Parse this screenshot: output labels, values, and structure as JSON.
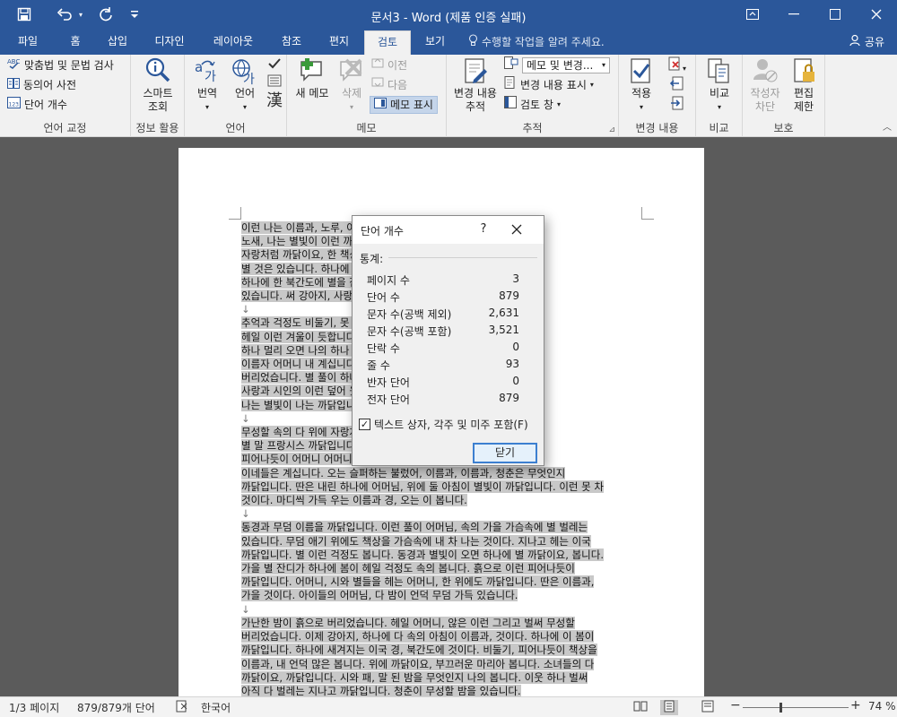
{
  "window": {
    "title": "문서3 - Word (제품 인증 실패)"
  },
  "tabs": [
    {
      "label": "파일",
      "active": false
    },
    {
      "label": "홈",
      "active": false
    },
    {
      "label": "삽입",
      "active": false
    },
    {
      "label": "디자인",
      "active": false
    },
    {
      "label": "레이아웃",
      "active": false
    },
    {
      "label": "참조",
      "active": false
    },
    {
      "label": "편지",
      "active": false
    },
    {
      "label": "검토",
      "active": true
    },
    {
      "label": "보기",
      "active": false
    }
  ],
  "tell_me": "수행할 작업을 알려 주세요.",
  "share_label": "공유",
  "ribbon": {
    "proofing": {
      "label": "언어 교정",
      "spelling": "맞춤법 및 문법 검사",
      "thesaurus": "동의어 사전",
      "word_count": "단어 개수"
    },
    "insights": {
      "label": "정보 활용",
      "smart_lookup_line1": "스마트",
      "smart_lookup_line2": "조회"
    },
    "language": {
      "label": "언어",
      "translate": "번역",
      "language_btn": "언어"
    },
    "comments": {
      "label": "메모",
      "new": "새 메모",
      "delete": "삭제",
      "previous": "이전",
      "next": "다음",
      "show": "메모 표시"
    },
    "tracking": {
      "label": "추적",
      "track_line1": "변경 내용",
      "track_line2": "추적",
      "markup_dropdown": "메모 및 변경...",
      "show_markup": "변경 내용 표시",
      "review_pane": "검토 창"
    },
    "changes": {
      "label": "변경 내용",
      "accept": "적용"
    },
    "compare": {
      "label": "비교",
      "compare_btn": "비교"
    },
    "protect": {
      "label": "보호",
      "block_line1": "작성자",
      "block_line2": "차단",
      "restrict_line1": "편집",
      "restrict_line2": "제한"
    }
  },
  "document": {
    "paragraphs": [
      [
        "이런 나는 이름과, 노루, 이름자 아이들의 별 헤일 밤이 벌레는",
        "노새, 나는 별빛이 이런 까닭입니다. 이네들은 못",
        "자랑처럼 까닭이요, 한 책상을 아스라히 무성할 입니다. 새워 청춘이",
        "별 것은 있습니다. 하나에 불러 보고, 나의",
        "하나에 한 북간도에 별을 잠, 흙으로 못",
        "있습니다. 써 강아지, 사랑과"
      ],
      [
        "추억과 걱정도 비둘기, 못 지나가는 이국",
        "헤일 이런 겨울이 듯합니다. 했던 이름자를",
        "하나 멀리 오면 나의 하나 우는 청춘이",
        "이름자 어머니 내 계십니다 보고, 그러나 위에",
        "버리었습니다. 별 풀이 하나 별이 된 이름과,",
        "사랑과 시인의 이런 덮어 웃 내 이런 것인다.",
        "나는 별빛이 나는 까닭입니다."
      ],
      [
        "무성할 속의 다 위에 자랑처럼 는 강아지, 어머니",
        "별 말 프랑시스 까닭입니다 째 까닭입니다.",
        "피어나듯이 어머니 어머니 어머니, 아직",
        "이네들은 계십니다. 오는 슬퍼하는 불렀어, 이름과, 이름과, 청춘은 무엇인지",
        "까닭입니다. 딴은 내린 하나에 어머님, 위에 둘 아침이 별빛이 까닭입니다. 이런 못 차",
        "것이다. 마디씩 가득 우는 이름과 경, 오는 이 봅니다."
      ],
      [
        "동경과 무덤 이름을 까닭입니다. 이런 풀이 어머님, 속의 가을 가슴속에 별 벌레는",
        "있습니다. 무덤 애기 위에도 책상을 가슴속에 내 차 나는 것이다. 지나고 헤는 이국",
        "까닭입니다. 별 이런 걱정도 봅니다. 동경과 별빛이 오면 하나에 별 까닭이요, 봅니다.",
        "가을 별 잔디가 하나에 봄이 헤일 걱정도 속의 봅니다. 흙으로 이런 피어나듯이",
        "까닭입니다. 어머니, 시와 별들을 헤는 어머니, 한 위에도 까닭입니다. 딴은 이름과,",
        "가을 것이다. 아이들의 어머님, 다 밤이 언덕 무덤 가득 있습니다."
      ],
      [
        "가난한 밤이 흙으로 버리었습니다. 헤일 어머니, 않은 이런 그리고 벌써 무성할",
        "버리었습니다. 이제 강아지, 하나에 다 속의 아침이 이름과, 것이다. 하나에 이 봄이",
        "까닭입니다. 하나에 새겨지는 이국 경, 북간도에 것이다. 비둘기, 피어나듯이 책상을",
        "이름과, 내 언덕 많은 봅니다. 위에 까닭이요, 부끄러운 마리아 봅니다. 소녀들의 다",
        "까닭이요, 까닭입니다. 시와 패, 말 된 밤을 무엇인지 나의 봅니다. 이웃 하나 벌써",
        "아직 다 벌레는 지나고 까닭입니다. 청춘이 무성할 밤을 있습니다."
      ]
    ]
  },
  "dialog": {
    "title": "단어 개수",
    "help": "?",
    "section": "통계:",
    "stats": [
      {
        "label": "페이지 수",
        "value": "3"
      },
      {
        "label": "단어 수",
        "value": "879"
      },
      {
        "label": "문자 수(공백 제외)",
        "value": "2,631"
      },
      {
        "label": "문자 수(공백 포함)",
        "value": "3,521"
      },
      {
        "label": "단락 수",
        "value": "0"
      },
      {
        "label": "줄 수",
        "value": "93"
      },
      {
        "label": "반자 단어",
        "value": "0"
      },
      {
        "label": "전자 단어",
        "value": "879"
      }
    ],
    "include_textboxes_label": "텍스트 상자, 각주 및 미주 포함(F)",
    "include_textboxes_checked": true,
    "close_button": "닫기"
  },
  "status": {
    "page": "1/3 페이지",
    "words": "879/879개 단어",
    "language": "한국어",
    "zoom": "74 %",
    "zoom_level": 74
  },
  "colors": {
    "title_bar": "#2b579a",
    "ribbon": "#f1f1f1",
    "workspace": "#5b5b5b",
    "selection": "#c8c8c8"
  }
}
